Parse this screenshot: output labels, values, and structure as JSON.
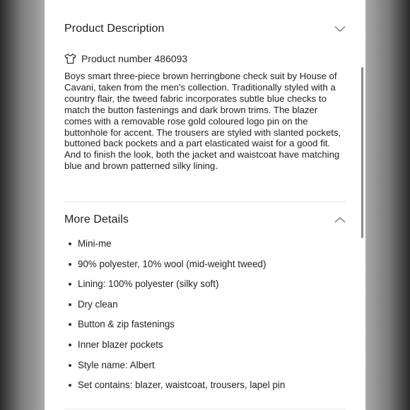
{
  "description_section": {
    "title": "Product Description",
    "chevron_icon": "chevron-down-icon",
    "product_number": "Product number 486093",
    "product_icon": "t-shirt-icon",
    "text": "Boys smart three-piece brown herringbone check suit by House of Cavani, taken from the men's collection. Traditionally styled with a country flair, the tweed fabric incorporates subtle blue checks to match the button fastenings and dark brown trims. The blazer comes with a removable rose gold coloured logo pin on the buttonhole for accent. The trousers are styled with slanted pockets, buttoned back pockets and a part elasticated waist for a good fit. And to finish the look, both the jacket and waistcoat have matching blue and brown patterned silky lining."
  },
  "more_details_section": {
    "title": "More Details",
    "chevron_icon": "chevron-up-icon",
    "items": [
      "Mini-me",
      "90% polyester, 10% wool (mid-weight tweed)",
      "Lining: 100% polyester (silky soft)",
      "Dry clean",
      "Button & zip fastenings",
      "Inner blazer pockets",
      "Style name: Albert",
      "Set contains: blazer, waistcoat, trousers, lapel pin"
    ]
  },
  "colors": {
    "background": "#ffffff",
    "text": "#222222",
    "divider": "#e6e6e6",
    "chevron": "#8a8a8a"
  }
}
